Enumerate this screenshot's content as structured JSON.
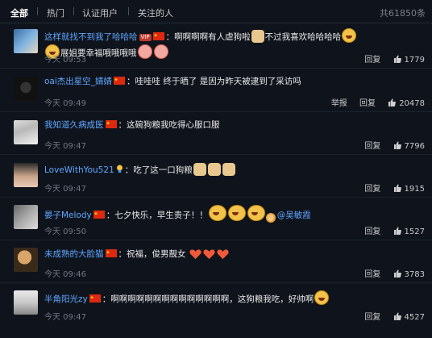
{
  "tabs": [
    {
      "label": "全部"
    },
    {
      "label": "热门"
    },
    {
      "label": "认证用户"
    },
    {
      "label": "关注的人"
    }
  ],
  "total_count": "共61850条",
  "icons": {
    "flag": "china-flag-icon",
    "like": "thumb-up-icon",
    "vip": "vip-badge-icon",
    "bulb": "lightbulb-icon",
    "at": "mention-icon"
  },
  "colors": {
    "link": "#5fa6ff",
    "background": "#0f141c",
    "flag_red": "#de2910",
    "flag_yellow": "#ffde00"
  },
  "actions": {
    "reply": "回复",
    "report": "举报"
  },
  "comments": [
    {
      "user": "这样就找不到我了哈哈哈",
      "line1": "：啊啊啊啊有人虐狗啦",
      "line1b": "不过我喜欢哈哈哈哈",
      "line2": "展姐要幸福哦哦哦哦",
      "time": "今天 09:53",
      "likes": "1779"
    },
    {
      "user": "oai杰出星空_婧婧",
      "text": "：哇哇哇 终于晒了 是因为昨天被逮到了采访吗",
      "time": "今天 09:49",
      "likes": "20478"
    },
    {
      "user": "我知道久病成医",
      "text": "：这碗狗粮我吃得心服口服",
      "time": "今天 09:47",
      "likes": "7796"
    },
    {
      "user": "LoveWithYou521",
      "text": "：吃了这一口狗粮",
      "time": "今天 09:47",
      "likes": "1915"
    },
    {
      "user": "晏子Melody",
      "text": "：七夕快乐，早生贵子！！",
      "mention": "@吴敏霞",
      "time": "今天 09:50",
      "likes": "1527"
    },
    {
      "user": "未成熟的大脸猫",
      "text": "：祝福，俊男靓女",
      "time": "今天 09:46",
      "likes": "3783"
    },
    {
      "user": "半角阳光zy",
      "text": "：啊啊啊啊啊啊啊啊啊啊啊啊啊啊，这狗粮我吃，好帅啊",
      "time": "今天 09:47",
      "likes": "4527"
    }
  ]
}
